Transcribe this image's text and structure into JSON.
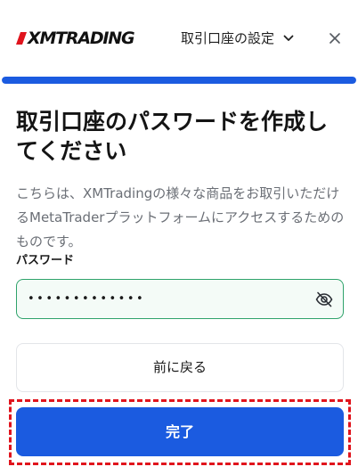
{
  "header": {
    "logo_text": "XMTRADING",
    "settings_label": "取引口座の設定",
    "chevron_icon": "chevron-down-icon",
    "close_icon": "close-icon"
  },
  "progress": {
    "value": 1.0
  },
  "main": {
    "title": "取引口座のパスワードを作成してください",
    "description": "こちらは、XMTradingの様々な商品をお取引いただけるMetaTraderプラットフォームにアクセスするためのものです。",
    "password_label": "パスワード",
    "password_value": "•••••••••••••",
    "visibility_icon": "eye-off-icon"
  },
  "buttons": {
    "back_label": "前に戻る",
    "complete_label": "完了"
  },
  "colors": {
    "primary": "#1b5be0",
    "logo_red": "#e0141d",
    "field_border": "#2fa36b",
    "highlight": "#e0141d"
  }
}
